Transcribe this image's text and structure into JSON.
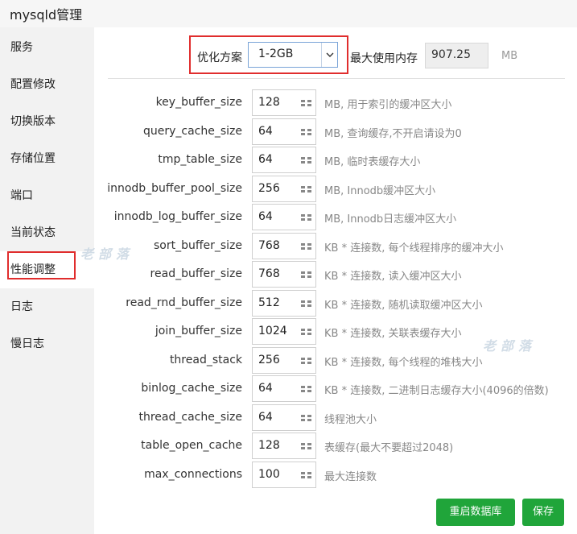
{
  "window": {
    "title": "mysqld管理"
  },
  "sidebar": {
    "items": [
      {
        "label": "服务"
      },
      {
        "label": "配置修改"
      },
      {
        "label": "切换版本"
      },
      {
        "label": "存储位置"
      },
      {
        "label": "端口"
      },
      {
        "label": "当前状态"
      },
      {
        "label": "性能调整"
      },
      {
        "label": "日志"
      },
      {
        "label": "慢日志"
      }
    ],
    "active_index": 6
  },
  "plan": {
    "label": "优化方案",
    "selected": "1-2GB",
    "max_mem_label": "最大使用内存",
    "max_mem_value": "907.25",
    "max_mem_unit": "MB"
  },
  "params": [
    {
      "name": "key_buffer_size",
      "value": "128",
      "desc": "MB, 用于索引的缓冲区大小"
    },
    {
      "name": "query_cache_size",
      "value": "64",
      "desc": "MB, 查询缓存,不开启请设为0"
    },
    {
      "name": "tmp_table_size",
      "value": "64",
      "desc": "MB, 临时表缓存大小"
    },
    {
      "name": "innodb_buffer_pool_size",
      "value": "256",
      "desc": "MB, Innodb缓冲区大小"
    },
    {
      "name": "innodb_log_buffer_size",
      "value": "64",
      "desc": "MB, Innodb日志缓冲区大小"
    },
    {
      "name": "sort_buffer_size",
      "value": "768",
      "desc": "KB * 连接数, 每个线程排序的缓冲大小"
    },
    {
      "name": "read_buffer_size",
      "value": "768",
      "desc": "KB * 连接数, 读入缓冲区大小"
    },
    {
      "name": "read_rnd_buffer_size",
      "value": "512",
      "desc": "KB * 连接数, 随机读取缓冲区大小"
    },
    {
      "name": "join_buffer_size",
      "value": "1024",
      "desc": "KB * 连接数, 关联表缓存大小"
    },
    {
      "name": "thread_stack",
      "value": "256",
      "desc": "KB * 连接数, 每个线程的堆栈大小"
    },
    {
      "name": "binlog_cache_size",
      "value": "64",
      "desc": "KB * 连接数, 二进制日志缓存大小(4096的倍数)"
    },
    {
      "name": "thread_cache_size",
      "value": "64",
      "desc": "线程池大小"
    },
    {
      "name": "table_open_cache",
      "value": "128",
      "desc": "表缓存(最大不要超过2048)"
    },
    {
      "name": "max_connections",
      "value": "100",
      "desc": "最大连接数"
    }
  ],
  "buttons": {
    "restart": "重启数据库",
    "save": "保存"
  },
  "watermark": "老部落",
  "colors": {
    "accent": "#20a53a",
    "highlight_border": "#e02d2d",
    "sidebar_bg": "#f2f2f2"
  }
}
